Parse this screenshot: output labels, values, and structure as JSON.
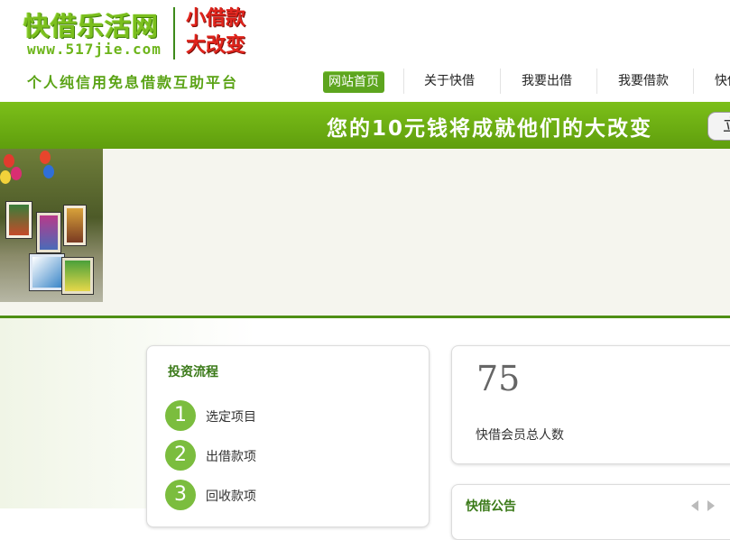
{
  "header": {
    "logo_main": "快借乐活网",
    "logo_url": "www.517jie.com",
    "slogan": "小借款大改变",
    "tagline": "个人纯信用免息借款互助平台"
  },
  "nav": {
    "items": [
      {
        "label": "网站首页",
        "active": true
      },
      {
        "label": "关于快借"
      },
      {
        "label": "我要出借"
      },
      {
        "label": "我要借款"
      },
      {
        "label": "快借"
      }
    ]
  },
  "banner": {
    "text": "您的10元钱将成就他们的大改变",
    "button_label": "立即"
  },
  "invest_flow": {
    "title": "投资流程",
    "steps": [
      {
        "num": "1",
        "label": "选定项目"
      },
      {
        "num": "2",
        "label": "出借款项"
      },
      {
        "num": "3",
        "label": "回收款项"
      }
    ]
  },
  "stats": {
    "member_count": "75",
    "member_label": "快借会员总人数"
  },
  "notice": {
    "title": "快借公告"
  },
  "colors": {
    "brand_green": "#7bbf19",
    "dark_green": "#4e8f14",
    "slogan_red": "#e0241c"
  }
}
